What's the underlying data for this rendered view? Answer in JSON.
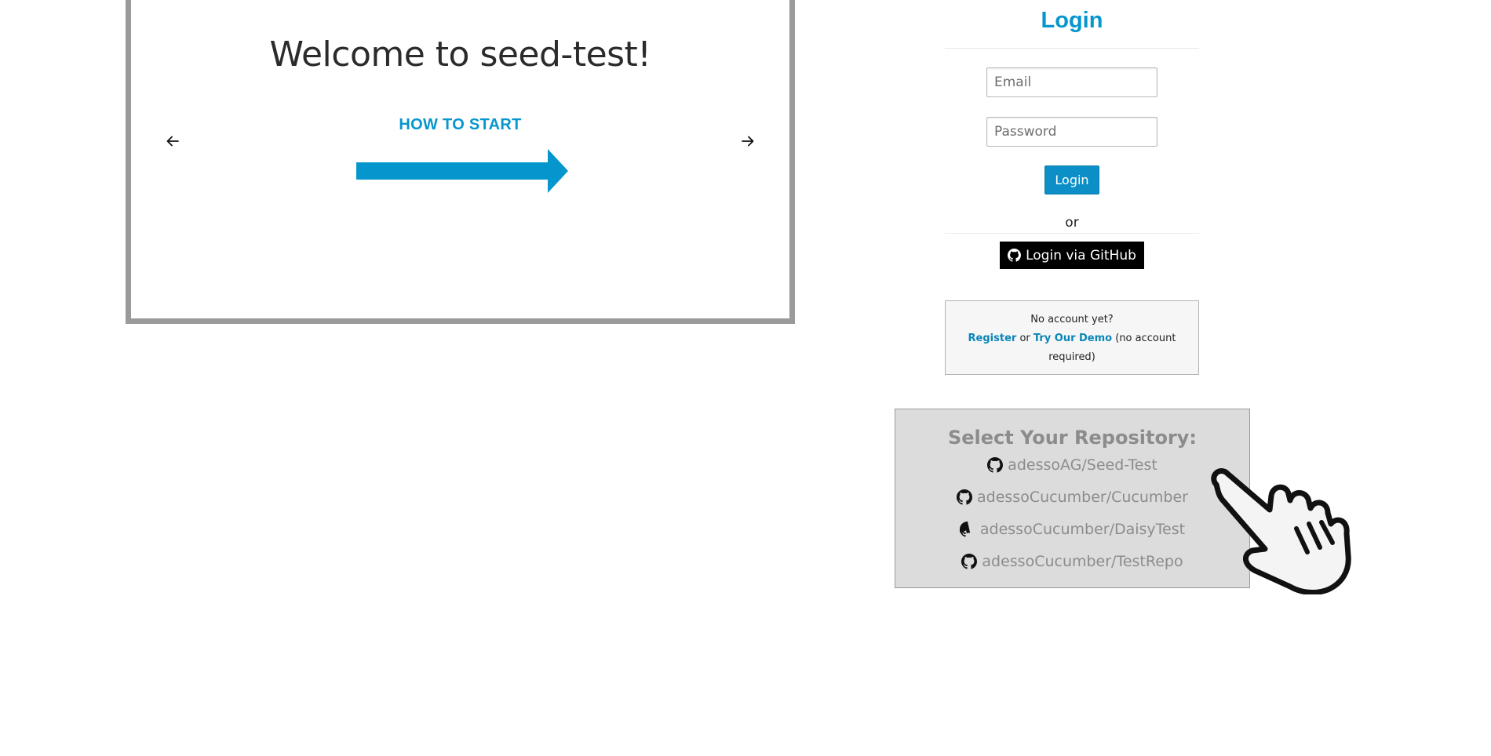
{
  "carousel": {
    "title": "Welcome to seed-test!",
    "slide_label": "HOW TO START",
    "accent_color": "#0696ce",
    "prev_icon": "arrow-left-icon",
    "next_icon": "arrow-right-icon"
  },
  "login": {
    "heading": "Login",
    "email_placeholder": "Email",
    "password_placeholder": "Password",
    "login_button": "Login",
    "or_text": "or",
    "github_button": "Login via GitHub",
    "no_account_text": "No account yet?",
    "register_link": "Register",
    "or_word": "or",
    "demo_link": "Try Our Demo",
    "no_account_required": "(no account required)",
    "accent_color": "#0696ce"
  },
  "repositories": {
    "title": "Select Your Repository:",
    "items": [
      "adessoAG/Seed-Test",
      "adessoCucumber/Cucumber",
      "adessoCucumber/DaisyTest",
      "adessoCucumber/TestRepo"
    ],
    "icon": "github-icon"
  }
}
